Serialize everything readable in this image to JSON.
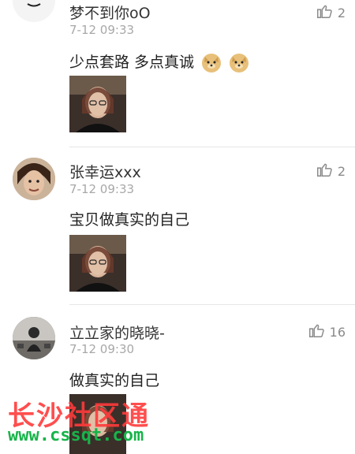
{
  "comments": [
    {
      "username": "梦不到你oO",
      "time": "7-12 09:33",
      "text": "少点套路 多点真诚",
      "likes": "2",
      "avatar_icon": "cartoon-face",
      "avatar_caption": "",
      "emojis": [
        "doge-emoji",
        "doge-emoji"
      ]
    },
    {
      "username": "张幸运xxx",
      "time": "7-12 09:33",
      "text": "宝贝做真实的自己",
      "likes": "2",
      "avatar_icon": "person-photo"
    },
    {
      "username": "立立家的晓晓-",
      "time": "7-12 09:30",
      "text": "做真实的自己",
      "likes": "16",
      "avatar_icon": "person-photo"
    }
  ],
  "watermark": {
    "title": "长沙社区通",
    "url": "www.cssqt.com",
    "title_color": "#ff3b3b",
    "url_color": "#17b44a"
  }
}
